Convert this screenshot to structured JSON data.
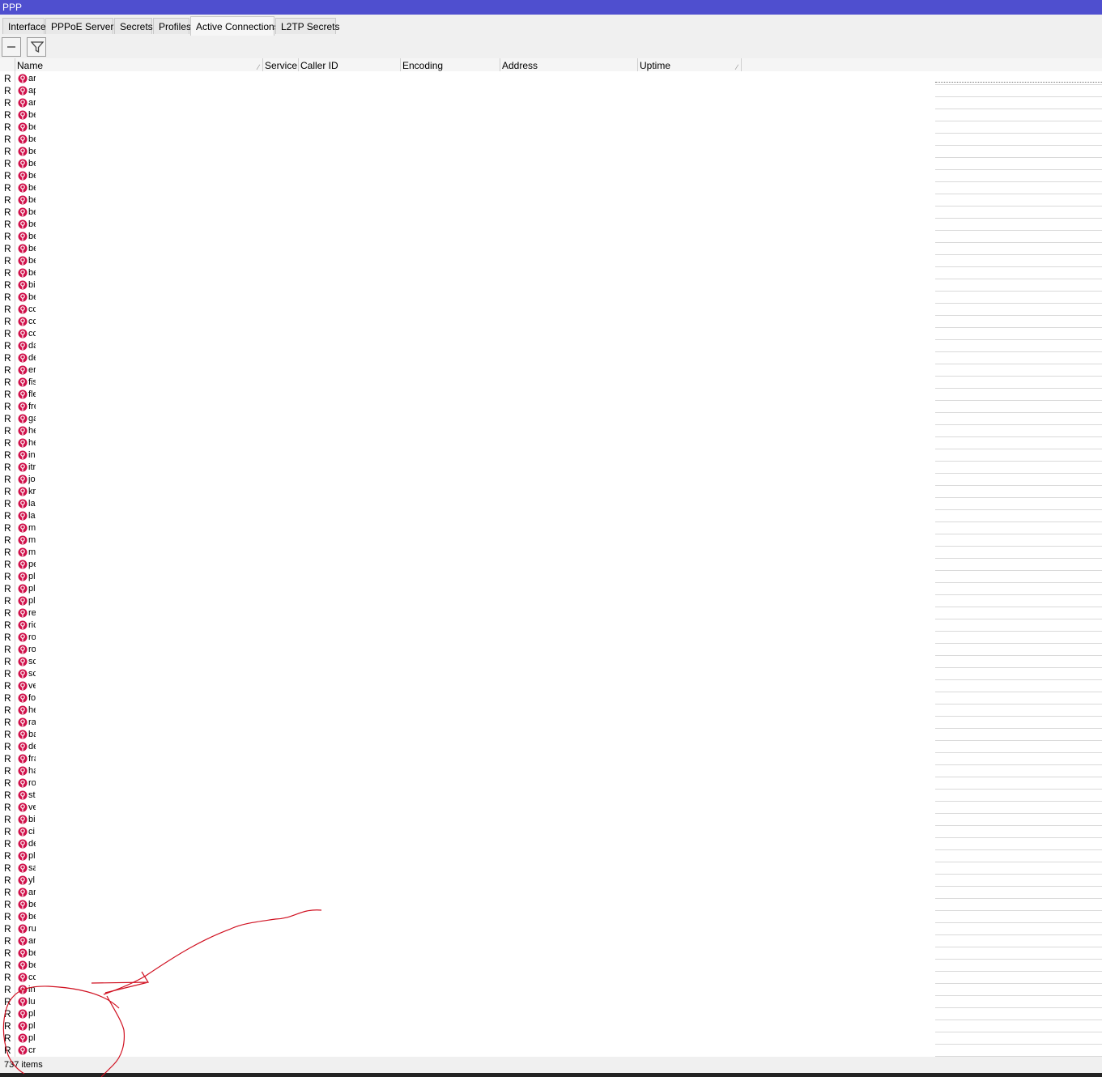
{
  "window": {
    "title": "PPP"
  },
  "tabs": [
    {
      "label": "Interface",
      "active": false
    },
    {
      "label": "PPPoE Servers",
      "active": false
    },
    {
      "label": "Secrets",
      "active": false
    },
    {
      "label": "Profiles",
      "active": false
    },
    {
      "label": "Active Connections",
      "active": true
    },
    {
      "label": "L2TP Secrets",
      "active": false
    }
  ],
  "toolbar": {
    "buttons": [
      "remove-icon",
      "filter-icon"
    ]
  },
  "columns": [
    "Name",
    "Service",
    "Caller ID",
    "Encoding",
    "Address",
    "Uptime"
  ],
  "rows": [
    {
      "flag": "R",
      "name": "ar"
    },
    {
      "flag": "R",
      "name": "ap"
    },
    {
      "flag": "R",
      "name": "ar"
    },
    {
      "flag": "R",
      "name": "be"
    },
    {
      "flag": "R",
      "name": "be"
    },
    {
      "flag": "R",
      "name": "be"
    },
    {
      "flag": "R",
      "name": "be"
    },
    {
      "flag": "R",
      "name": "be"
    },
    {
      "flag": "R",
      "name": "be"
    },
    {
      "flag": "R",
      "name": "be"
    },
    {
      "flag": "R",
      "name": "be"
    },
    {
      "flag": "R",
      "name": "be"
    },
    {
      "flag": "R",
      "name": "be"
    },
    {
      "flag": "R",
      "name": "be"
    },
    {
      "flag": "R",
      "name": "be"
    },
    {
      "flag": "R",
      "name": "be"
    },
    {
      "flag": "R",
      "name": "be"
    },
    {
      "flag": "R",
      "name": "bi"
    },
    {
      "flag": "R",
      "name": "be"
    },
    {
      "flag": "R",
      "name": "cc"
    },
    {
      "flag": "R",
      "name": "cc"
    },
    {
      "flag": "R",
      "name": "cc"
    },
    {
      "flag": "R",
      "name": "da"
    },
    {
      "flag": "R",
      "name": "de"
    },
    {
      "flag": "R",
      "name": "er"
    },
    {
      "flag": "R",
      "name": "fis"
    },
    {
      "flag": "R",
      "name": "fle"
    },
    {
      "flag": "R",
      "name": "fre"
    },
    {
      "flag": "R",
      "name": "ga"
    },
    {
      "flag": "R",
      "name": "he"
    },
    {
      "flag": "R",
      "name": "he"
    },
    {
      "flag": "R",
      "name": "in"
    },
    {
      "flag": "R",
      "name": "itr"
    },
    {
      "flag": "R",
      "name": "jo"
    },
    {
      "flag": "R",
      "name": "kr"
    },
    {
      "flag": "R",
      "name": "la"
    },
    {
      "flag": "R",
      "name": "la"
    },
    {
      "flag": "R",
      "name": "m"
    },
    {
      "flag": "R",
      "name": "m"
    },
    {
      "flag": "R",
      "name": "m"
    },
    {
      "flag": "R",
      "name": "pe"
    },
    {
      "flag": "R",
      "name": "pl"
    },
    {
      "flag": "R",
      "name": "pl"
    },
    {
      "flag": "R",
      "name": "pl"
    },
    {
      "flag": "R",
      "name": "re"
    },
    {
      "flag": "R",
      "name": "ric"
    },
    {
      "flag": "R",
      "name": "ro"
    },
    {
      "flag": "R",
      "name": "ro"
    },
    {
      "flag": "R",
      "name": "sc"
    },
    {
      "flag": "R",
      "name": "sc"
    },
    {
      "flag": "R",
      "name": "ve"
    },
    {
      "flag": "R",
      "name": "fo"
    },
    {
      "flag": "R",
      "name": "he"
    },
    {
      "flag": "R",
      "name": "ra"
    },
    {
      "flag": "R",
      "name": "ba"
    },
    {
      "flag": "R",
      "name": "de"
    },
    {
      "flag": "R",
      "name": "fra"
    },
    {
      "flag": "R",
      "name": "ha"
    },
    {
      "flag": "R",
      "name": "ro"
    },
    {
      "flag": "R",
      "name": "st"
    },
    {
      "flag": "R",
      "name": "ve"
    },
    {
      "flag": "R",
      "name": "bi"
    },
    {
      "flag": "R",
      "name": "ci"
    },
    {
      "flag": "R",
      "name": "de"
    },
    {
      "flag": "R",
      "name": "pl"
    },
    {
      "flag": "R",
      "name": "sa"
    },
    {
      "flag": "R",
      "name": "yl"
    },
    {
      "flag": "R",
      "name": "ar"
    },
    {
      "flag": "R",
      "name": "be"
    },
    {
      "flag": "R",
      "name": "be"
    },
    {
      "flag": "R",
      "name": "ru"
    },
    {
      "flag": "R",
      "name": "ar"
    },
    {
      "flag": "R",
      "name": "be"
    },
    {
      "flag": "R",
      "name": "be"
    },
    {
      "flag": "R",
      "name": "cc"
    },
    {
      "flag": "R",
      "name": "in"
    },
    {
      "flag": "R",
      "name": "lu"
    },
    {
      "flag": "R",
      "name": "pl"
    },
    {
      "flag": "R",
      "name": "pl"
    },
    {
      "flag": "R",
      "name": "pl"
    },
    {
      "flag": "R",
      "name": "cr"
    }
  ],
  "status": {
    "item_count": "737 items"
  },
  "colors": {
    "titlebar": "#4f4fcf",
    "ppp_icon": "#d0104a",
    "annotation": "#d01020"
  }
}
